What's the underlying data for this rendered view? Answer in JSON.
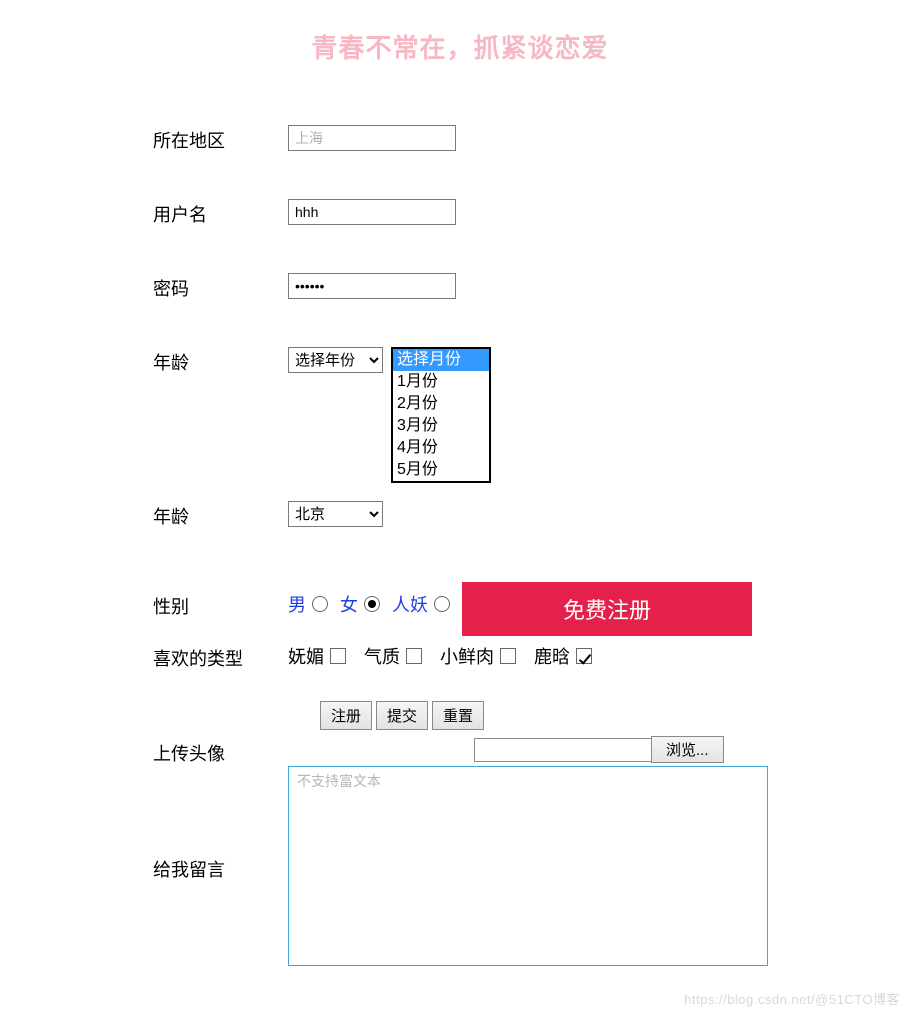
{
  "title": "青春不常在，抓紧谈恋爱",
  "labels": {
    "region": "所在地区",
    "username": "用户名",
    "password": "密码",
    "age1": "年龄",
    "age2": "年龄",
    "gender": "性别",
    "favtype": "喜欢的类型",
    "upload": "上传头像",
    "message": "给我留言"
  },
  "region": {
    "placeholder": "上海",
    "value": ""
  },
  "username": {
    "value": "hhh"
  },
  "password": {
    "value": "••••••"
  },
  "yearSelect": {
    "selected": "选择年份"
  },
  "monthList": {
    "options": [
      "选择月份",
      "1月份",
      "2月份",
      "3月份",
      "4月份",
      "5月份"
    ],
    "selectedIndex": 0
  },
  "citySelect": {
    "selected": "北京"
  },
  "gender": {
    "options": [
      {
        "label": "男",
        "checked": false
      },
      {
        "label": "女",
        "checked": true
      },
      {
        "label": "人妖",
        "checked": false
      }
    ]
  },
  "favtype": {
    "options": [
      {
        "label": "妩媚",
        "checked": false
      },
      {
        "label": "气质",
        "checked": false
      },
      {
        "label": "小鲜肉",
        "checked": false
      },
      {
        "label": "鹿晗",
        "checked": true
      }
    ]
  },
  "buttons": {
    "register": "注册",
    "submit": "提交",
    "reset": "重置",
    "bigRegister": "免费注册",
    "browse": "浏览..."
  },
  "message": {
    "placeholder": "不支持富文本",
    "value": ""
  },
  "watermark": "https://blog.csdn.net/@51CTO博客"
}
